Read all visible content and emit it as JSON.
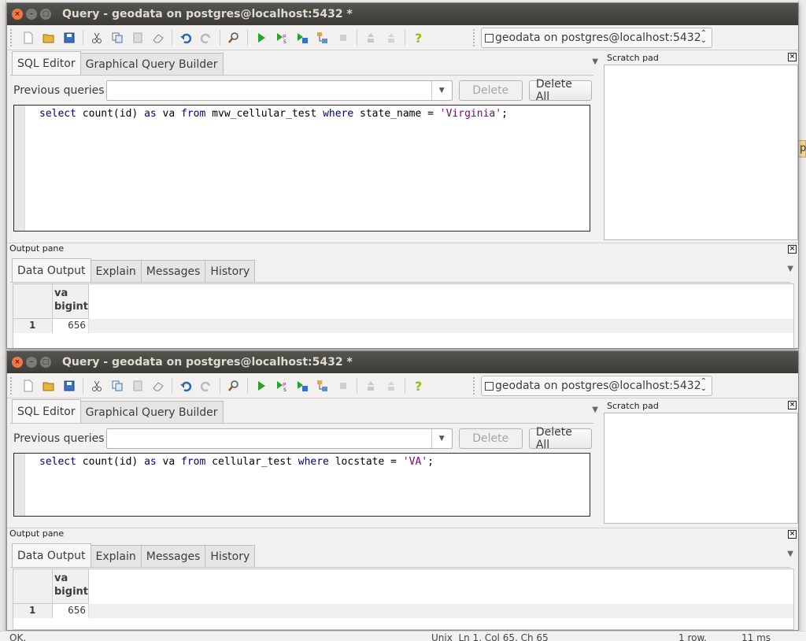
{
  "window1": {
    "title": "Query - geodata on postgres@localhost:5432 *",
    "connection": "geodata on postgres@localhost:5432",
    "editor_tabs": [
      "SQL Editor",
      "Graphical Query Builder"
    ],
    "previous_queries_label": "Previous queries",
    "delete_label": "Delete",
    "delete_all_label": "Delete All",
    "sql": {
      "k1": "select",
      "t1": " count(id) ",
      "k2": "as",
      "t2": " va ",
      "k3": "from",
      "t3": " mvw_cellular_test ",
      "k4": "where",
      "t4": " state_name = ",
      "s1": "'Virginia'",
      "t5": ";"
    },
    "scratch_title": "Scratch pad",
    "output_title": "Output pane",
    "output_tabs": [
      "Data Output",
      "Explain",
      "Messages",
      "History"
    ],
    "result": {
      "col_name": "va",
      "col_type": "bigint",
      "row_num": "1",
      "value": "656"
    }
  },
  "window2": {
    "title": "Query - geodata on postgres@localhost:5432 *",
    "connection": "geodata on postgres@localhost:5432",
    "editor_tabs": [
      "SQL Editor",
      "Graphical Query Builder"
    ],
    "previous_queries_label": "Previous queries",
    "delete_label": "Delete",
    "delete_all_label": "Delete All",
    "sql": {
      "k1": "select",
      "t1": " count(id) ",
      "k2": "as",
      "t2": " va ",
      "k3": "from",
      "t3": " cellular_test ",
      "k4": "where",
      "t4": " locstate = ",
      "s1": "'VA'",
      "t5": ";"
    },
    "scratch_title": "Scratch pad",
    "output_title": "Output pane",
    "output_tabs": [
      "Data Output",
      "Explain",
      "Messages",
      "History"
    ],
    "result": {
      "col_name": "va",
      "col_type": "bigint",
      "row_num": "1",
      "value": "656"
    }
  },
  "statusbar": {
    "status": "OK.",
    "position": "Unix  Ln 1, Col 65, Ch 65",
    "rows": "1 row.",
    "time": "11 ms"
  },
  "colors": {
    "titlebar": "#3c3b37",
    "close_button": "#f07746",
    "keyword": "#00007f",
    "string": "#7f007f"
  }
}
